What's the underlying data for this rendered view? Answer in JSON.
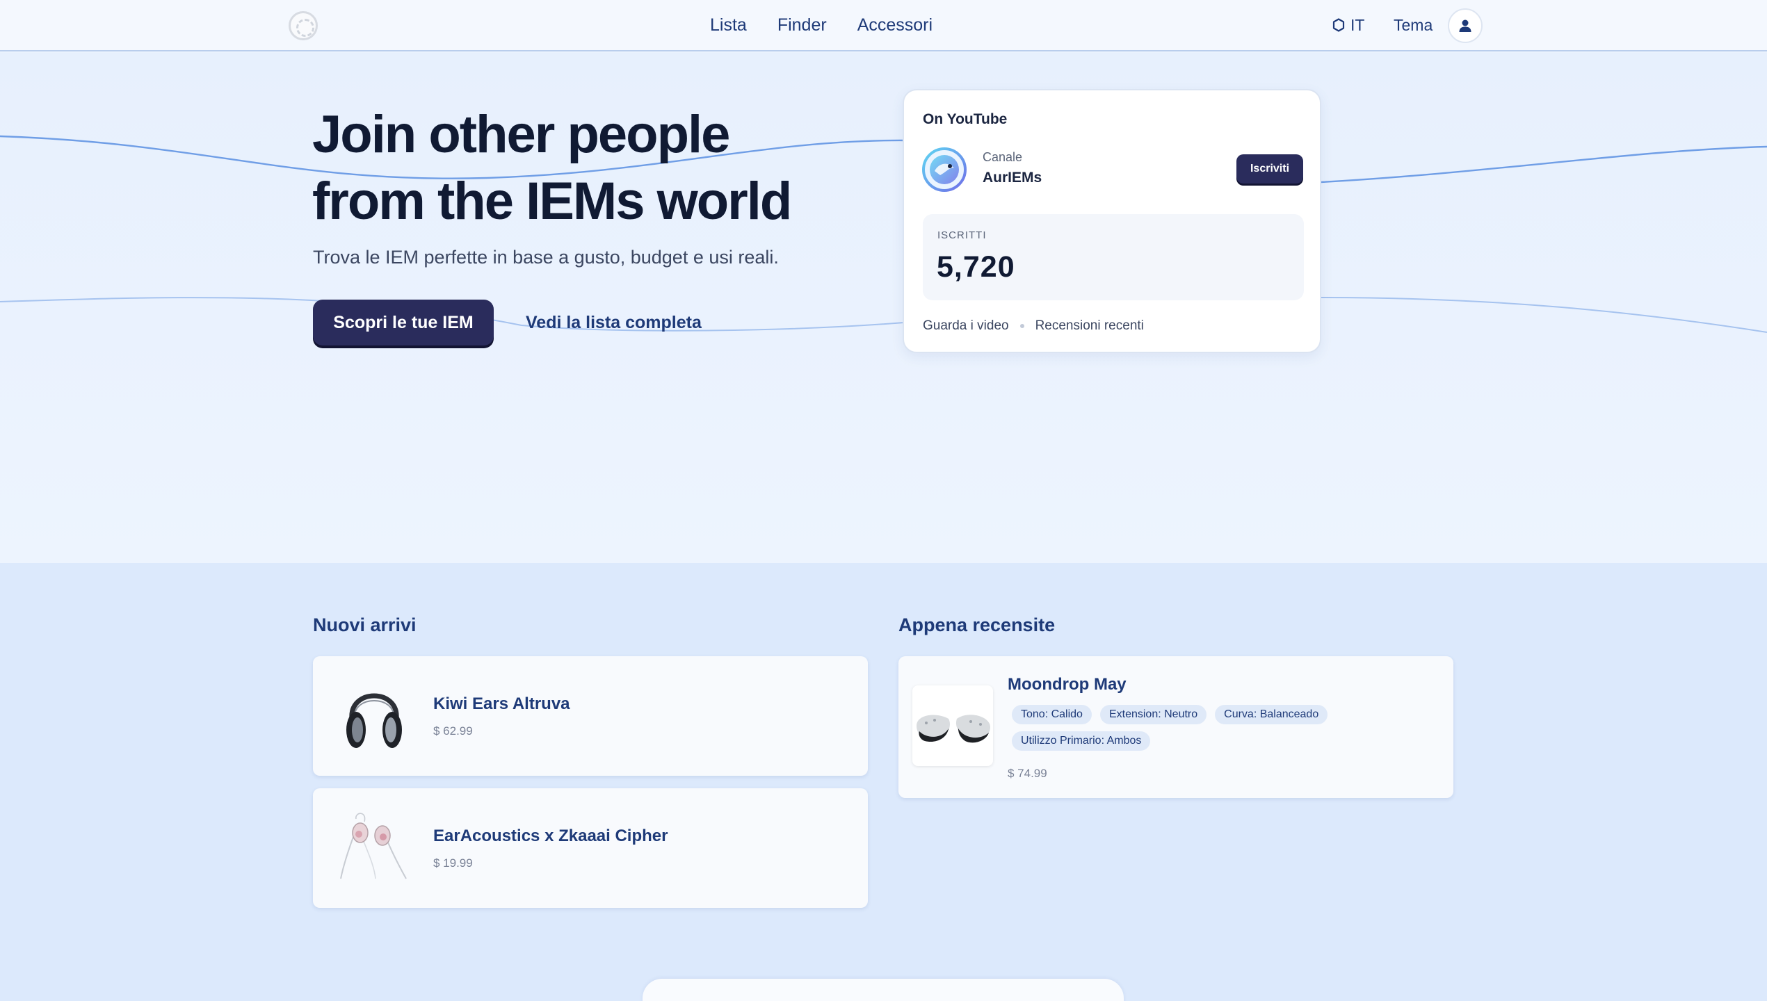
{
  "nav": {
    "links": [
      "Lista",
      "Finder",
      "Accessori"
    ],
    "language": "IT",
    "theme_label": "Tema"
  },
  "hero": {
    "title_line1": "Join other people",
    "title_line2": "from the IEMs world",
    "subtitle": "Trova le IEM perfette in base a gusto, budget e usi reali.",
    "cta_primary": "Scopri le tue IEM",
    "cta_secondary": "Vedi la lista completa"
  },
  "youtube": {
    "heading": "On YouTube",
    "channel_label": "Canale",
    "channel_name": "AurIEMs",
    "subscribe_label": "Iscriviti",
    "subscribers_label": "ISCRITTI",
    "subscribers_value": "5,720",
    "link_videos": "Guarda i video",
    "link_reviews": "Recensioni recenti"
  },
  "new_arrivals": {
    "title": "Nuovi arrivi",
    "items": [
      {
        "name": "Kiwi Ears Altruva",
        "price": "$ 62.99"
      },
      {
        "name": "EarAcoustics x Zkaaai Cipher",
        "price": "$ 19.99"
      }
    ]
  },
  "recently_reviewed": {
    "title": "Appena recensite",
    "items": [
      {
        "name": "Moondrop May",
        "tags": [
          "Tono: Calido",
          "Extension: Neutro",
          "Curva: Balanceado",
          "Utilizzo Primario: Ambos"
        ],
        "price": "$ 74.99"
      }
    ]
  },
  "colors": {
    "accent_dark": "#2a2c5c",
    "link_blue": "#1e3a78",
    "hero_bg": "#e7f0fd",
    "section_bg": "#dce9fc",
    "tag_bg": "#dfe9f8"
  },
  "icons": [
    "logo-icon",
    "hexagon-icon",
    "user-icon",
    "channel-avatar-icon"
  ]
}
